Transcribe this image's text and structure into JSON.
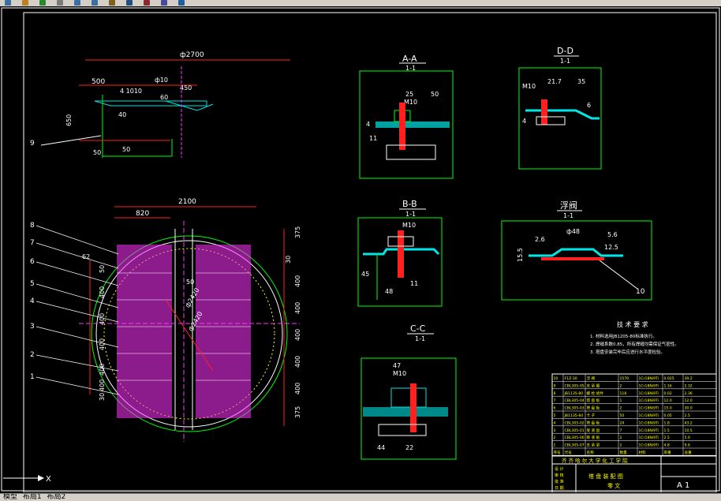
{
  "colors": {
    "background": "#000000",
    "frame": "#ffffff",
    "outline": "#00ff00",
    "dim": "#ff2020",
    "cyan": "#00e5e5",
    "magenta": "#ff33ff",
    "yellow": "#ffff00",
    "text": "#ffffff"
  },
  "toolbar": {
    "icons": [
      "new-icon",
      "open-icon",
      "save-icon",
      "print-icon",
      "undo-icon",
      "redo-icon",
      "zoom-icon",
      "pan-icon",
      "properties-icon",
      "layer-icon",
      "help-icon"
    ]
  },
  "tabs": {
    "model": "模型",
    "layout1": "布局1",
    "layout2": "布局2"
  },
  "top_view": {
    "overall_width": "ф2700",
    "d500": "500",
    "d10_10": "4 1010",
    "d10": "ф10",
    "d60": "60",
    "d450": "450",
    "d650": "650",
    "d50a": "50",
    "d50b": "50",
    "d40": "40",
    "callout_9": "9"
  },
  "plan_view": {
    "d2100": "2100",
    "d820": "820",
    "d62": "62",
    "d50": "50",
    "d2420": "ф2420",
    "d2420b": "ф2420",
    "right_dims": [
      "375",
      "30",
      "400",
      "400",
      "400",
      "400",
      "400",
      "375"
    ],
    "left_dims": [
      "50",
      "400",
      "400",
      "400",
      "400",
      "400",
      "30"
    ],
    "callouts": [
      "8",
      "7",
      "6",
      "5",
      "4",
      "3",
      "2",
      "1"
    ]
  },
  "section_aa": {
    "title": "A-A",
    "scale": "1-1",
    "d25": "25",
    "d50": "50",
    "m10": "M10",
    "d4": "4",
    "d11": "11"
  },
  "section_dd": {
    "title": "D-D",
    "scale": "1-1",
    "m10": "M10",
    "d21_7": "21.7",
    "d35": "35",
    "d6": "6",
    "d4": "4"
  },
  "section_bb": {
    "title": "B-B",
    "scale": "1-1",
    "m10": "M10",
    "d45": "45",
    "d48": "48",
    "d11": "11"
  },
  "float_valve": {
    "title": "浮阀",
    "scale": "1-1",
    "d48": "ф48",
    "d2_6": "2.6",
    "d5_6": "5.6",
    "d15_5": "15.5",
    "d12_5": "12.5",
    "callout_10": "10"
  },
  "section_cc": {
    "title": "C-C",
    "scale": "1-1",
    "d47": "47",
    "m10": "M10",
    "d44": "44",
    "d22": "22"
  },
  "notes": {
    "title": "技 术 要 求",
    "items": [
      "1. 材料选用JB1205-80标准执行。",
      "2. 焊缝系数0.85，所有焊缝均需保证气密性。",
      "3. 塔盘安装完毕后应进行水平度检验。"
    ]
  },
  "parts_table": {
    "rows": [
      [
        "10",
        "F1Z-30",
        "浮 阀",
        "1570",
        "1Cr18Ni9Ti",
        "0.025",
        "39.2"
      ],
      [
        "9",
        "CBL305-05",
        "支 承 圈",
        "2",
        "1Cr18Ni9Ti",
        "1.16",
        "2.32"
      ],
      [
        "8",
        "JB1135-80",
        "螺 栓 组件",
        "118",
        "1Cr18Ni9Ti",
        "0.02",
        "2.36"
      ],
      [
        "7",
        "CBL305-04",
        "塔 盘 板",
        "1",
        "1Cr18Ni9Ti",
        "12.0",
        "12.0"
      ],
      [
        "6",
        "CBL305-03",
        "塔 盘 板",
        "2",
        "1Cr18Ni9Ti",
        "15.0",
        "30.0"
      ],
      [
        "5",
        "JB1135-84",
        "卡 子",
        "50",
        "1Cr18Ni9Ti",
        "0.05",
        "2.5"
      ],
      [
        "4",
        "CBL305-02",
        "塔 盘 板",
        "24",
        "1Cr18Ni9Ti",
        "1.8",
        "43.2"
      ],
      [
        "3",
        "CBL305-01",
        "受 液 盘",
        "7",
        "1Cr18Ni9Ti",
        "1.5",
        "10.5"
      ],
      [
        "2",
        "CBL305-06",
        "降 液 板",
        "2",
        "1Cr18Ni9Ti",
        "2.5",
        "5.0"
      ],
      [
        "1",
        "CBL305-07",
        "支 承 梁",
        "2",
        "1Cr18Ni9Ti",
        "4.8",
        "9.6"
      ]
    ],
    "header": [
      "序号",
      "代号",
      "名称",
      "数量",
      "材料",
      "单重",
      "总重"
    ]
  },
  "title_block": {
    "school": "齐 齐 哈 尔 大 学 化 工 学 院",
    "drawing_name": "塔 盘 装 配 图",
    "drawing_sub": "零 文",
    "sheet": "A 1",
    "labels": [
      "设 计",
      "审 核",
      "批 准",
      "日 期"
    ]
  },
  "command": {
    "prompt": "X"
  }
}
